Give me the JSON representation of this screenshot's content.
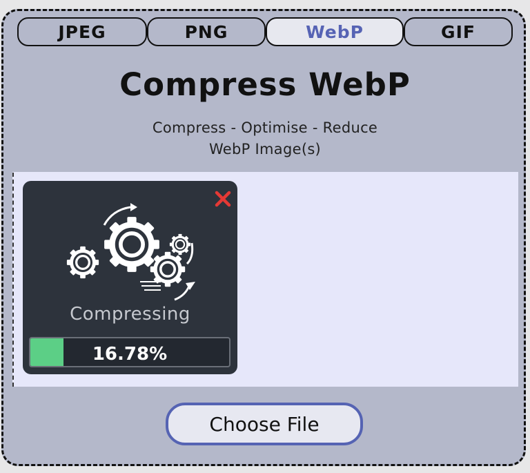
{
  "tabs": [
    {
      "label": "JPEG",
      "active": false
    },
    {
      "label": "PNG",
      "active": false
    },
    {
      "label": "WebP",
      "active": true
    },
    {
      "label": "GIF",
      "active": false
    }
  ],
  "header": {
    "title": "Compress WebP",
    "subtitle_line1": "Compress - Optimise - Reduce",
    "subtitle_line2": "WebP Image(s)"
  },
  "file_card": {
    "status": "Compressing",
    "progress_text": "16.78%",
    "progress_value": 0.1678,
    "icon": "gears-icon",
    "close_icon": "close-icon"
  },
  "upload": {
    "button_label": "Choose File"
  },
  "colors": {
    "panel_bg": "#b4b8ca",
    "accent": "#5663b4",
    "dropzone_bg": "#e6e7fa",
    "card_bg": "#2d333c",
    "progress_fill": "#5ccf86",
    "close_red": "#e53935"
  }
}
